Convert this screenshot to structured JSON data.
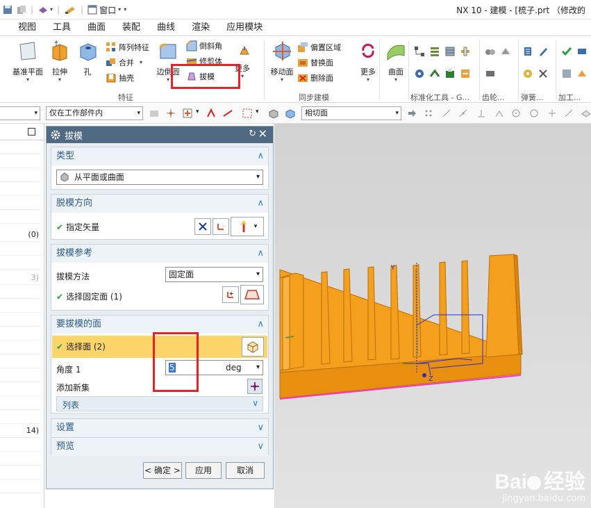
{
  "titlebar": {
    "window_menu": "窗口",
    "title": "NX 10 - 建模 - [梳子.prt （修改的"
  },
  "menu_tabs": [
    "视图",
    "工具",
    "曲面",
    "装配",
    "曲线",
    "渲染",
    "应用模块"
  ],
  "ribbon": {
    "datum_plane": "基准平面",
    "extrude": "拉伸",
    "hole": "孔",
    "pattern_feature": "阵列特征",
    "unite": "合并",
    "shell": "抽壳",
    "edge_blend": "边倒圆",
    "chamfer": "倒斜角",
    "trim_body": "修剪体",
    "draft": "拔模",
    "more1": "更多",
    "group_feature": "特征",
    "move_face": "移动面",
    "offset_region": "偏置区域",
    "replace_face": "替换面",
    "delete_face": "删除面",
    "more2": "更多",
    "group_sync": "同步建模",
    "surface": "曲面",
    "group_std": "标准化工具 - G...",
    "group_gear": "齿轮...",
    "group_spring": "弹簧...",
    "group_machining": "加工..."
  },
  "cmdbar": {
    "filter": "仅在工作部件内",
    "snap": "相切面"
  },
  "navigator": {
    "rows": [
      "(0)",
      "3)",
      "14)"
    ]
  },
  "dialog": {
    "title": "拔模",
    "type": {
      "label": "类型",
      "value": "从平面或曲面"
    },
    "direction": {
      "label": "脱模方向",
      "vector": "指定矢量"
    },
    "reference": {
      "label": "拔模参考",
      "method_label": "拔模方法",
      "method_value": "固定面",
      "fixed_face": "选择固定面 (1)"
    },
    "faces": {
      "label": "要拔模的面",
      "select": "选择面 (2)",
      "angle_label": "角度 1",
      "angle_value": "5",
      "angle_unit": "deg",
      "add_set": "添加新集",
      "list": "列表"
    },
    "settings": "设置",
    "preview": "预览",
    "ok": "< 确定 >",
    "apply": "应用",
    "cancel": "取消"
  },
  "viewport": {
    "triad_y": "Y",
    "triad_z": "Z"
  },
  "watermark": {
    "brand": "Bai",
    "brand2": "经验",
    "url": "jingyan.baidu.com"
  },
  "colors": {
    "part": "#f5a01d",
    "dialog_title": "#4f6a82",
    "highlight": "#e8202a",
    "selected_row": "#fcd56a"
  }
}
